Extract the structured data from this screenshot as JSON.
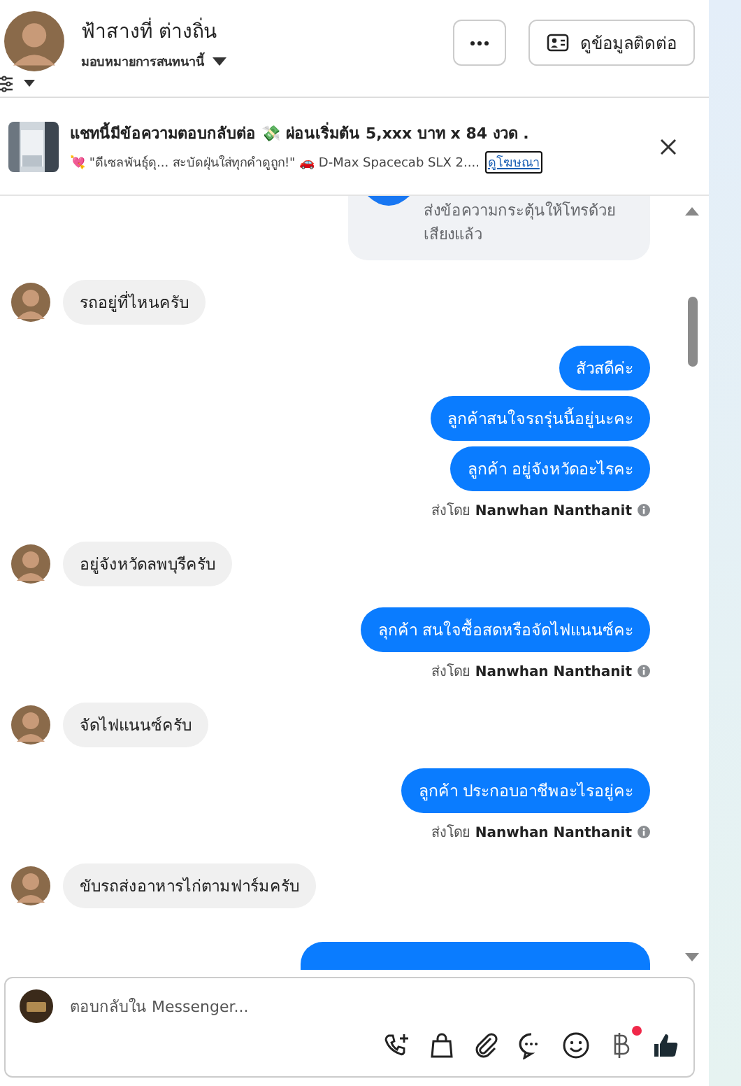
{
  "header": {
    "name": "ฟ้าสางที่ ต่างถิ่น",
    "assign_label": "มอบหมายการสนทนานี้",
    "contact_button": "ดูข้อมูลติดต่อ"
  },
  "ad_banner": {
    "title": "แชทนี้มีข้อความตอบกลับต่อ 💸 ผ่อนเริ่มต้น 5,xxx บาท x 84 งวด .",
    "text": "💘 \"ดีเซลพันธุ์ดุ... สะบัดฝุ่นใส่ทุกคำดูถูก!\" 🚗 D-Max Spacecab SLX 2....",
    "link": "ดูโฆษณา"
  },
  "messages": [
    {
      "kind": "card",
      "text": "ส่งข้อความกระตุ้นให้โทรด้วยเสียงแล้ว"
    },
    {
      "kind": "incoming",
      "text": "รถอยู่ที่ไหนครับ"
    },
    {
      "kind": "outgoing",
      "text": "สัวสดีค่ะ"
    },
    {
      "kind": "outgoing",
      "text": "ลูกค้าสนใจรถรุ่นนี้อยู่นะคะ"
    },
    {
      "kind": "outgoing",
      "text": "ลูกค้า อยู่จังหวัดอะไรคะ"
    },
    {
      "kind": "note",
      "prefix": "ส่งโดย",
      "sender": "Nanwhan Nanthanit"
    },
    {
      "kind": "incoming",
      "text": "อยู่จังหวัดลพบุรีครับ"
    },
    {
      "kind": "outgoing",
      "text": "ลุกค้า  สนใจซื้อสดหรือจัดไฟแนนซ์คะ"
    },
    {
      "kind": "note",
      "prefix": "ส่งโดย",
      "sender": "Nanwhan Nanthanit"
    },
    {
      "kind": "incoming",
      "text": "จัดไฟแนนซ์ครับ"
    },
    {
      "kind": "outgoing",
      "text": "ลูกค้า ประกอบอาชีพอะไรอยู่คะ"
    },
    {
      "kind": "note",
      "prefix": "ส่งโดย",
      "sender": "Nanwhan Nanthanit"
    },
    {
      "kind": "incoming",
      "text": "ขับรถส่งอาหารไก่ตามฟาร์มครับ"
    },
    {
      "kind": "cut"
    }
  ],
  "composer": {
    "placeholder": "ตอบกลับใน Messenger...",
    "currency_badge": true
  }
}
